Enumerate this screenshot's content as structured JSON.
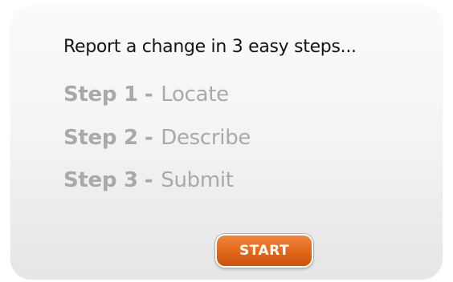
{
  "title": "Report a change in 3 easy steps...",
  "steps": [
    {
      "number": "Step 1",
      "separator": "-",
      "action": "Locate"
    },
    {
      "number": "Step 2",
      "separator": "-",
      "action": "Describe"
    },
    {
      "number": "Step 3",
      "separator": "-",
      "action": "Submit"
    }
  ],
  "start_button": {
    "label": "START"
  },
  "colors": {
    "heading": "#141414",
    "step_text": "#a9a9a9",
    "button": "#e0661a",
    "panel": "#f4f4f4"
  }
}
